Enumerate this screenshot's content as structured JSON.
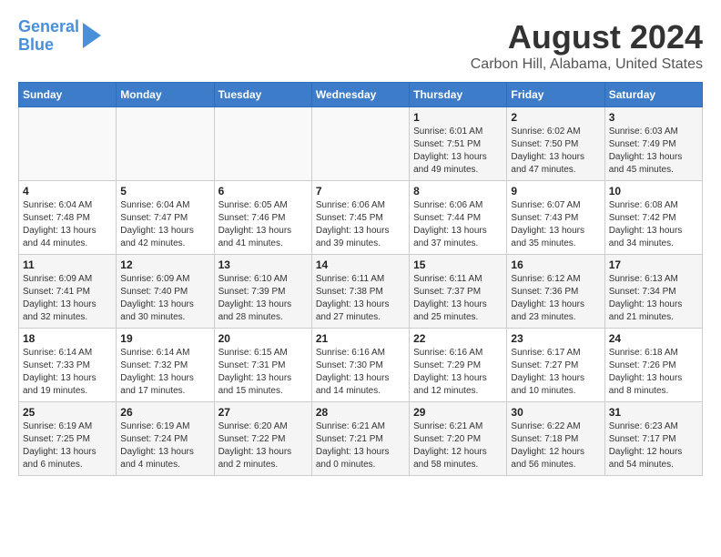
{
  "header": {
    "logo_line1": "General",
    "logo_line2": "Blue",
    "title": "August 2024",
    "subtitle": "Carbon Hill, Alabama, United States"
  },
  "weekdays": [
    "Sunday",
    "Monday",
    "Tuesday",
    "Wednesday",
    "Thursday",
    "Friday",
    "Saturday"
  ],
  "weeks": [
    [
      {
        "day": "",
        "info": ""
      },
      {
        "day": "",
        "info": ""
      },
      {
        "day": "",
        "info": ""
      },
      {
        "day": "",
        "info": ""
      },
      {
        "day": "1",
        "info": "Sunrise: 6:01 AM\nSunset: 7:51 PM\nDaylight: 13 hours\nand 49 minutes."
      },
      {
        "day": "2",
        "info": "Sunrise: 6:02 AM\nSunset: 7:50 PM\nDaylight: 13 hours\nand 47 minutes."
      },
      {
        "day": "3",
        "info": "Sunrise: 6:03 AM\nSunset: 7:49 PM\nDaylight: 13 hours\nand 45 minutes."
      }
    ],
    [
      {
        "day": "4",
        "info": "Sunrise: 6:04 AM\nSunset: 7:48 PM\nDaylight: 13 hours\nand 44 minutes."
      },
      {
        "day": "5",
        "info": "Sunrise: 6:04 AM\nSunset: 7:47 PM\nDaylight: 13 hours\nand 42 minutes."
      },
      {
        "day": "6",
        "info": "Sunrise: 6:05 AM\nSunset: 7:46 PM\nDaylight: 13 hours\nand 41 minutes."
      },
      {
        "day": "7",
        "info": "Sunrise: 6:06 AM\nSunset: 7:45 PM\nDaylight: 13 hours\nand 39 minutes."
      },
      {
        "day": "8",
        "info": "Sunrise: 6:06 AM\nSunset: 7:44 PM\nDaylight: 13 hours\nand 37 minutes."
      },
      {
        "day": "9",
        "info": "Sunrise: 6:07 AM\nSunset: 7:43 PM\nDaylight: 13 hours\nand 35 minutes."
      },
      {
        "day": "10",
        "info": "Sunrise: 6:08 AM\nSunset: 7:42 PM\nDaylight: 13 hours\nand 34 minutes."
      }
    ],
    [
      {
        "day": "11",
        "info": "Sunrise: 6:09 AM\nSunset: 7:41 PM\nDaylight: 13 hours\nand 32 minutes."
      },
      {
        "day": "12",
        "info": "Sunrise: 6:09 AM\nSunset: 7:40 PM\nDaylight: 13 hours\nand 30 minutes."
      },
      {
        "day": "13",
        "info": "Sunrise: 6:10 AM\nSunset: 7:39 PM\nDaylight: 13 hours\nand 28 minutes."
      },
      {
        "day": "14",
        "info": "Sunrise: 6:11 AM\nSunset: 7:38 PM\nDaylight: 13 hours\nand 27 minutes."
      },
      {
        "day": "15",
        "info": "Sunrise: 6:11 AM\nSunset: 7:37 PM\nDaylight: 13 hours\nand 25 minutes."
      },
      {
        "day": "16",
        "info": "Sunrise: 6:12 AM\nSunset: 7:36 PM\nDaylight: 13 hours\nand 23 minutes."
      },
      {
        "day": "17",
        "info": "Sunrise: 6:13 AM\nSunset: 7:34 PM\nDaylight: 13 hours\nand 21 minutes."
      }
    ],
    [
      {
        "day": "18",
        "info": "Sunrise: 6:14 AM\nSunset: 7:33 PM\nDaylight: 13 hours\nand 19 minutes."
      },
      {
        "day": "19",
        "info": "Sunrise: 6:14 AM\nSunset: 7:32 PM\nDaylight: 13 hours\nand 17 minutes."
      },
      {
        "day": "20",
        "info": "Sunrise: 6:15 AM\nSunset: 7:31 PM\nDaylight: 13 hours\nand 15 minutes."
      },
      {
        "day": "21",
        "info": "Sunrise: 6:16 AM\nSunset: 7:30 PM\nDaylight: 13 hours\nand 14 minutes."
      },
      {
        "day": "22",
        "info": "Sunrise: 6:16 AM\nSunset: 7:29 PM\nDaylight: 13 hours\nand 12 minutes."
      },
      {
        "day": "23",
        "info": "Sunrise: 6:17 AM\nSunset: 7:27 PM\nDaylight: 13 hours\nand 10 minutes."
      },
      {
        "day": "24",
        "info": "Sunrise: 6:18 AM\nSunset: 7:26 PM\nDaylight: 13 hours\nand 8 minutes."
      }
    ],
    [
      {
        "day": "25",
        "info": "Sunrise: 6:19 AM\nSunset: 7:25 PM\nDaylight: 13 hours\nand 6 minutes."
      },
      {
        "day": "26",
        "info": "Sunrise: 6:19 AM\nSunset: 7:24 PM\nDaylight: 13 hours\nand 4 minutes."
      },
      {
        "day": "27",
        "info": "Sunrise: 6:20 AM\nSunset: 7:22 PM\nDaylight: 13 hours\nand 2 minutes."
      },
      {
        "day": "28",
        "info": "Sunrise: 6:21 AM\nSunset: 7:21 PM\nDaylight: 13 hours\nand 0 minutes."
      },
      {
        "day": "29",
        "info": "Sunrise: 6:21 AM\nSunset: 7:20 PM\nDaylight: 12 hours\nand 58 minutes."
      },
      {
        "day": "30",
        "info": "Sunrise: 6:22 AM\nSunset: 7:18 PM\nDaylight: 12 hours\nand 56 minutes."
      },
      {
        "day": "31",
        "info": "Sunrise: 6:23 AM\nSunset: 7:17 PM\nDaylight: 12 hours\nand 54 minutes."
      }
    ]
  ]
}
